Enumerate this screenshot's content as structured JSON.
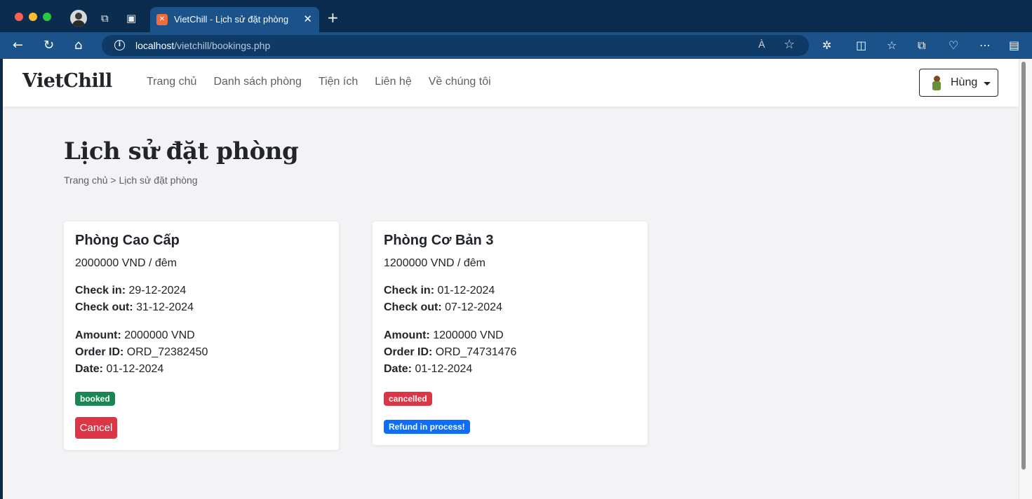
{
  "browser": {
    "tab_title": "VietChill - Lịch sử đặt phòng",
    "tab_favicon": "xampp-icon",
    "url_host": "localhost",
    "url_path": "/vietchill/bookings.php",
    "read_aloud_label": "À"
  },
  "site": {
    "brand": "VietChill",
    "menu": [
      "Trang chủ",
      "Danh sách phòng",
      "Tiện ích",
      "Liên hệ",
      "Về chúng tôi"
    ],
    "user_name": "Hùng"
  },
  "page": {
    "title": "Lịch sử đặt phòng",
    "breadcrumb": "Trang chủ > Lịch sử đặt phòng"
  },
  "labels": {
    "check_in": "Check in:",
    "check_out": "Check out:",
    "amount": "Amount:",
    "order_id": "Order ID:",
    "date": "Date:"
  },
  "bookings": [
    {
      "room": "Phòng Cao Cấp",
      "price": "2000000 VND / đêm",
      "check_in": "29-12-2024",
      "check_out": "31-12-2024",
      "amount": "2000000 VND",
      "order_id": "ORD_72382450",
      "date": "01-12-2024",
      "status": "booked",
      "status_color": "#198754",
      "action": "Cancel",
      "action_color": "#dc3545"
    },
    {
      "room": "Phòng Cơ Bản 3",
      "price": "1200000 VND / đêm",
      "check_in": "01-12-2024",
      "check_out": "07-12-2024",
      "amount": "1200000 VND",
      "order_id": "ORD_74731476",
      "date": "01-12-2024",
      "status": "cancelled",
      "status_color": "#dc3545",
      "note": "Refund in process!",
      "note_color": "#0d6efd"
    }
  ]
}
